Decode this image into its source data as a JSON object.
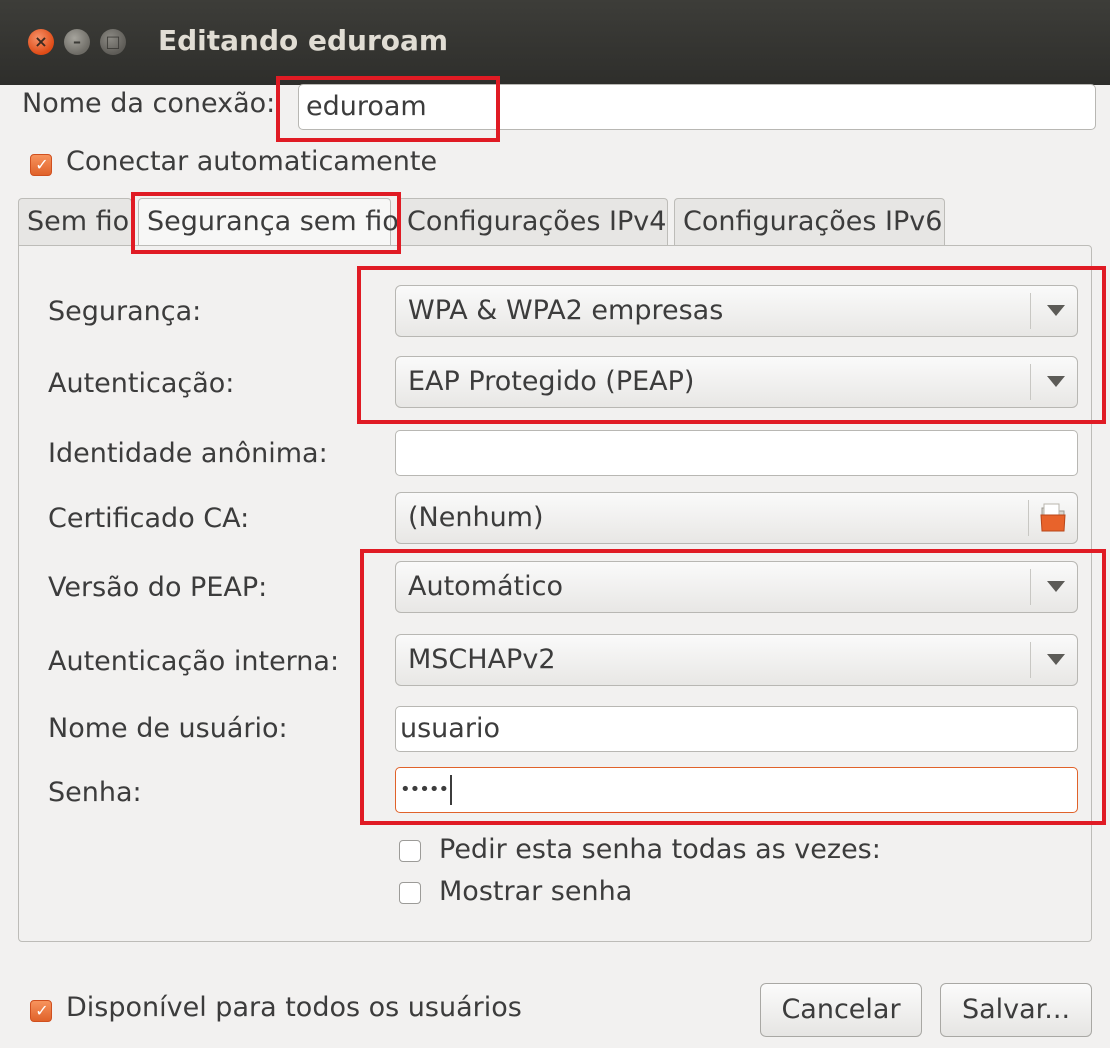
{
  "window": {
    "title": "Editando eduroam",
    "close_glyph": "×",
    "minimize_glyph": "–",
    "maximize_glyph": "□"
  },
  "connection": {
    "name_label": "Nome da conexão:",
    "name_value": "eduroam",
    "autoconnect_label": "Conectar automaticamente",
    "autoconnect_checked": true
  },
  "tabs": [
    {
      "label": "Sem fio",
      "active": false
    },
    {
      "label": "Segurança sem fio",
      "active": true
    },
    {
      "label": "Configurações IPv4",
      "active": false
    },
    {
      "label": "Configurações IPv6",
      "active": false
    }
  ],
  "security": {
    "security_label": "Segurança:",
    "security_value": "WPA & WPA2 empresas",
    "auth_label": "Autenticação:",
    "auth_value": "EAP Protegido (PEAP)",
    "anon_identity_label": "Identidade anônima:",
    "anon_identity_value": "",
    "ca_cert_label": "Certificado CA:",
    "ca_cert_value": "(Nenhum)",
    "peap_version_label": "Versão do PEAP:",
    "peap_version_value": "Automático",
    "inner_auth_label": "Autenticação interna:",
    "inner_auth_value": "MSCHAPv2",
    "username_label": "Nome de usuário:",
    "username_value": "usuario",
    "password_label": "Senha:",
    "password_value": "•••••",
    "ask_password_label": "Pedir esta senha todas as vezes:",
    "ask_password_checked": false,
    "show_password_label": "Mostrar senha",
    "show_password_checked": false
  },
  "footer": {
    "all_users_label": "Disponível para todos os usuários",
    "all_users_checked": true,
    "cancel_label": "Cancelar",
    "save_label": "Salvar..."
  },
  "colors": {
    "accent": "#e0622a",
    "highlight_box": "#e01b24",
    "titlebar": "#3c3b37"
  },
  "icons": {
    "checkbox_check": "✓",
    "folder": "folder-icon",
    "dropdown": "chevron-down-icon"
  }
}
